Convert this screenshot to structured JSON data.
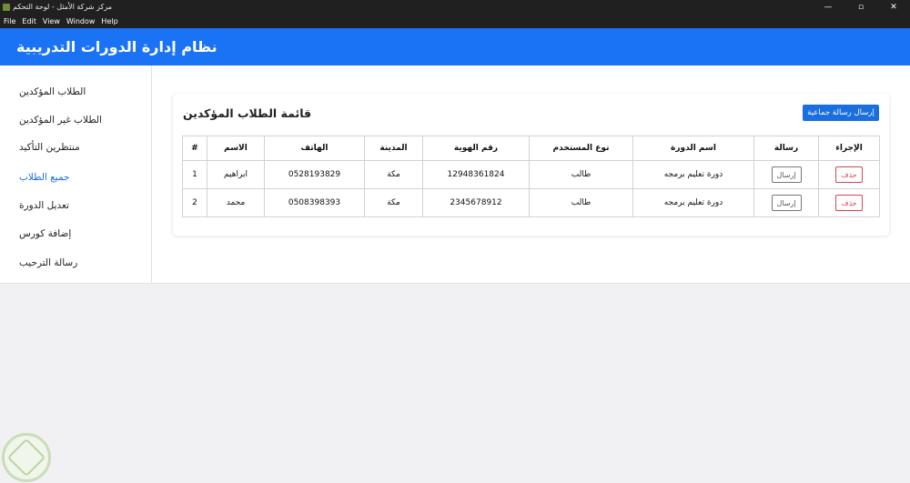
{
  "window": {
    "title": "مركز شركة الأمثل - لوحة التحكم",
    "controls": [
      "—",
      "▫",
      "✕"
    ]
  },
  "menu": [
    "File",
    "Edit",
    "View",
    "Window",
    "Help"
  ],
  "header": {
    "title": "نظام إدارة الدورات التدريبية"
  },
  "sidebar": {
    "items": [
      {
        "label": "الطلاب المؤكدين",
        "active": false
      },
      {
        "label": "الطلاب غير المؤكدين",
        "active": false
      },
      {
        "label": "منتظرين التأكيد",
        "active": false
      },
      {
        "label": "جميع الطلاب",
        "active": true
      },
      {
        "label": "تعديل الدورة",
        "active": false
      },
      {
        "label": "إضافة كورس",
        "active": false
      },
      {
        "label": "رسالة الترحيب",
        "active": false
      }
    ]
  },
  "card": {
    "title": "قائمة الطلاب المؤكدين",
    "broadcast_label": "إرسال رسالة جماعية"
  },
  "table": {
    "headers": [
      "#",
      "الاسم",
      "الهاتف",
      "المدينة",
      "رقم الهوية",
      "نوع المستخدم",
      "اسم الدورة",
      "رسالة",
      "الإجراء"
    ],
    "rows": [
      {
        "num": "1",
        "name": "ابراهيم",
        "phone": "0528193829",
        "city": "مكة",
        "id": "12948361824",
        "type": "طالب",
        "course": "دورة تعليم برمجه",
        "send": "إرسال",
        "delete": "حذف"
      },
      {
        "num": "2",
        "name": "محمد",
        "phone": "0508398393",
        "city": "مكة",
        "id": "2345678912",
        "type": "طالب",
        "course": "دورة تعليم برمجه",
        "send": "إرسال",
        "delete": "حذف"
      }
    ]
  },
  "colors": {
    "header": "#1a73f5",
    "accent": "#1a6fe0",
    "danger": "#d64550"
  }
}
